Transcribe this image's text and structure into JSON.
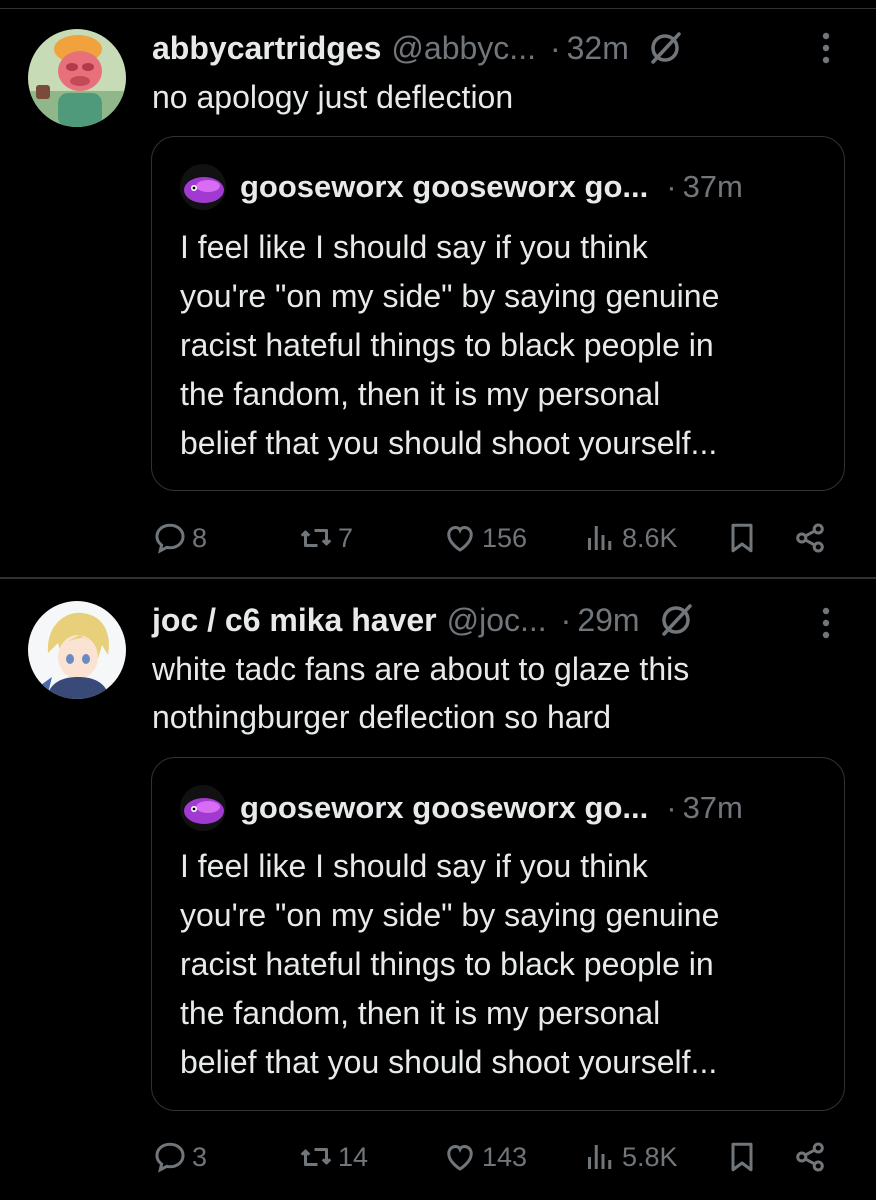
{
  "colors": {
    "background": "#000000",
    "text": "#e7e9ea",
    "muted": "#71767b",
    "border": "#2f3336"
  },
  "icons": [
    "grok-slash-icon",
    "more-vertical-icon",
    "reply-icon",
    "retweet-icon",
    "like-icon",
    "views-icon",
    "bookmark-icon",
    "share-icon"
  ],
  "posts": [
    {
      "name": "abbycartridges",
      "handle": "@abbyc...",
      "sep": "·",
      "time": "32m",
      "text_lines": [
        "no apology just deflection"
      ],
      "quote": {
        "name": "gooseworx gooseworx go...",
        "sep": "·",
        "time": "37m",
        "lines": [
          "I feel like I should say if you think",
          "you're \"on my side\" by saying genuine",
          "racist hateful things to black people in",
          "the fandom, then it is my personal",
          "belief that you should shoot yourself..."
        ]
      },
      "stats": {
        "replies": "8",
        "reposts": "7",
        "likes": "156",
        "views": "8.6K"
      }
    },
    {
      "name": "joc / c6 mika haver",
      "handle": "@joc...",
      "sep": "·",
      "time": "29m",
      "text_lines": [
        "white tadc fans are about to glaze this",
        "nothingburger deflection so hard"
      ],
      "quote": {
        "name": "gooseworx gooseworx go...",
        "sep": "·",
        "time": "37m",
        "lines": [
          "I feel like I should say if you think",
          "you're \"on my side\" by saying genuine",
          "racist hateful things to black people in",
          "the fandom, then it is my personal",
          "belief that you should shoot yourself..."
        ]
      },
      "stats": {
        "replies": "3",
        "reposts": "14",
        "likes": "143",
        "views": "5.8K"
      }
    }
  ]
}
